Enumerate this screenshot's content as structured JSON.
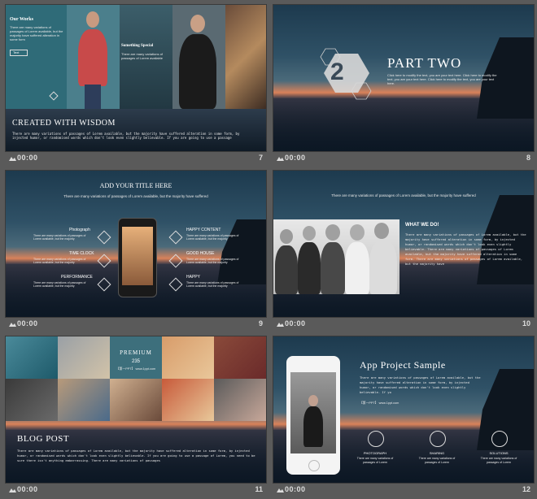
{
  "slides": [
    {
      "number": "7",
      "time": "00:00",
      "title": "CREATED WITH WISDOM",
      "body": "There are many variations of passages of Lorem available, but the majority have suffered alteration in some form, by injected humor, or randomised words which don't look even slightly believable. If you are going to use a passage",
      "side_title": "Our Works",
      "side_text": "There are many variations of passages of Lorem available, but the majority have suffered alteration in some form",
      "side_button": "Text",
      "overlay_title": "Something Special",
      "overlay_text": "There are many variations of passages of Lorem available"
    },
    {
      "number": "8",
      "time": "00:00",
      "title": "PART TWO",
      "badge": "2",
      "body": "Click here to modify the text, you are your text here. Click here to modify the text, you are your text here. Click here to modify the text, you are your text here."
    },
    {
      "number": "9",
      "time": "00:00",
      "title": "ADD YOUR TITLE HERE",
      "subtitle": "There are many variations of passages of Lorem available, but the majority have suffered",
      "left_items": [
        {
          "label": "Photograph",
          "text": "There are many variations of passages of Lorem available, but the majority"
        },
        {
          "label": "TIME CLOCK",
          "text": "There are many variations of passages of Lorem available, but the majority"
        },
        {
          "label": "PERFORMANCE",
          "text": "There are many variations of passages of Lorem available, but the majority"
        }
      ],
      "right_items": [
        {
          "label": "HAPPY CONTENT",
          "text": "There are many variations of passages of Lorem available, but the majority"
        },
        {
          "label": "GOOD HOUSE",
          "text": "There are many variations of passages of Lorem available, but the majority"
        },
        {
          "label": "HAPPY",
          "text": "There are many variations of passages of Lorem available, but the majority"
        }
      ]
    },
    {
      "number": "10",
      "time": "00:00",
      "subtitle": "There are many variations of passages of Lorem available, but the majority have suffered",
      "heading": "WHAT WE DO!",
      "body": "There are many variations of passages of Lorem available, but the majority have suffered alteration in some form, by injected humor, or randomised words which don't look even slightly believable. There are many variations of passages of Lorem available, but the majority have suffered alteration in some form. There are many variations of passages of Lorem available, but the majority have"
    },
    {
      "number": "11",
      "time": "00:00",
      "title": "BLOG POST",
      "premium": "PREMIUM",
      "premium_num": "235",
      "url": "【第一PPT】 www.1ppt.com",
      "body": "There are many variations of passages of Lorem available, but the majority have suffered alteration in some form, by injected humor, or randomised words which don't look even slightly believable. If you are going to use a passage of Lorem, you need to be sure there isn't anything embarrassing. There are many variations of passages"
    },
    {
      "number": "12",
      "time": "00:00",
      "title": "App Project Sample",
      "body": "There are many variations of passages of Lorem available, but the majority have suffered alteration in some form, by injected humor, or randomised words which don't look even slightly believable. If yo",
      "url": "【第一PPT】 www.1ppt.com",
      "features": [
        {
          "label": "PHOTOGRAPH",
          "text": "There are many variations of passages of Lorem"
        },
        {
          "label": "SHARING",
          "text": "There are many variations of passages of Lorem"
        },
        {
          "label": "SOLUTIONS",
          "text": "There are many variations of passages of Lorem"
        }
      ]
    }
  ]
}
